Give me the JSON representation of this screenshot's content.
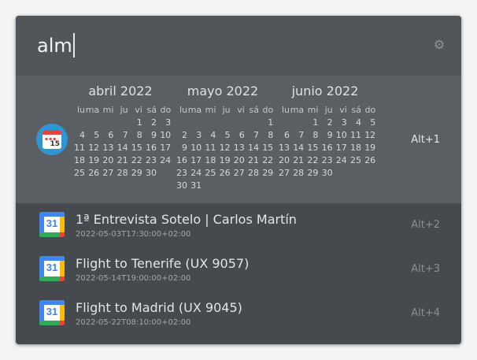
{
  "search": {
    "query": "alm"
  },
  "icons": {
    "settings": "gear-icon",
    "calendar": "calendar-icon",
    "google_calendar": "google-calendar-icon"
  },
  "calendar_icon_label": "15",
  "google_calendar_label": "31",
  "weekdays": [
    "lu",
    "ma",
    "mi",
    "ju",
    "vi",
    "sá",
    "do"
  ],
  "months": [
    {
      "title": "abril 2022",
      "weeks": [
        [
          "",
          "",
          "",
          "",
          "1",
          "2",
          "3"
        ],
        [
          "4",
          "5",
          "6",
          "7",
          "8",
          "9",
          "10"
        ],
        [
          "11",
          "12",
          "13",
          "14",
          "15",
          "16",
          "17"
        ],
        [
          "18",
          "19",
          "20",
          "21",
          "22",
          "23",
          "24"
        ],
        [
          "25",
          "26",
          "27",
          "28",
          "29",
          "30",
          ""
        ]
      ]
    },
    {
      "title": "mayo 2022",
      "weeks": [
        [
          "",
          "",
          "",
          "",
          "",
          "",
          "1"
        ],
        [
          "2",
          "3",
          "4",
          "5",
          "6",
          "7",
          "8"
        ],
        [
          "9",
          "10",
          "11",
          "12",
          "13",
          "14",
          "15"
        ],
        [
          "16",
          "17",
          "18",
          "19",
          "20",
          "21",
          "22"
        ],
        [
          "23",
          "24",
          "25",
          "26",
          "27",
          "28",
          "29"
        ],
        [
          "30",
          "31",
          "",
          "",
          "",
          "",
          ""
        ]
      ]
    },
    {
      "title": "junio 2022",
      "weeks": [
        [
          "",
          "",
          "1",
          "2",
          "3",
          "4",
          "5"
        ],
        [
          "6",
          "7",
          "8",
          "9",
          "10",
          "11",
          "12"
        ],
        [
          "13",
          "14",
          "15",
          "16",
          "17",
          "18",
          "19"
        ],
        [
          "20",
          "21",
          "22",
          "23",
          "24",
          "25",
          "26"
        ],
        [
          "27",
          "28",
          "29",
          "30",
          "",
          "",
          ""
        ]
      ]
    }
  ],
  "results": [
    {
      "shortcut": "Alt+1"
    },
    {
      "title": "1ª Entrevista Sotelo |  Carlos Martín",
      "subtitle": "2022-05-03T17:30:00+02:00",
      "shortcut": "Alt+2"
    },
    {
      "title": "Flight to Tenerife (UX 9057)",
      "subtitle": "2022-05-14T19:00:00+02:00",
      "shortcut": "Alt+3"
    },
    {
      "title": "Flight to Madrid (UX 9045)",
      "subtitle": "2022-05-22T08:10:00+02:00",
      "shortcut": "Alt+4"
    }
  ]
}
